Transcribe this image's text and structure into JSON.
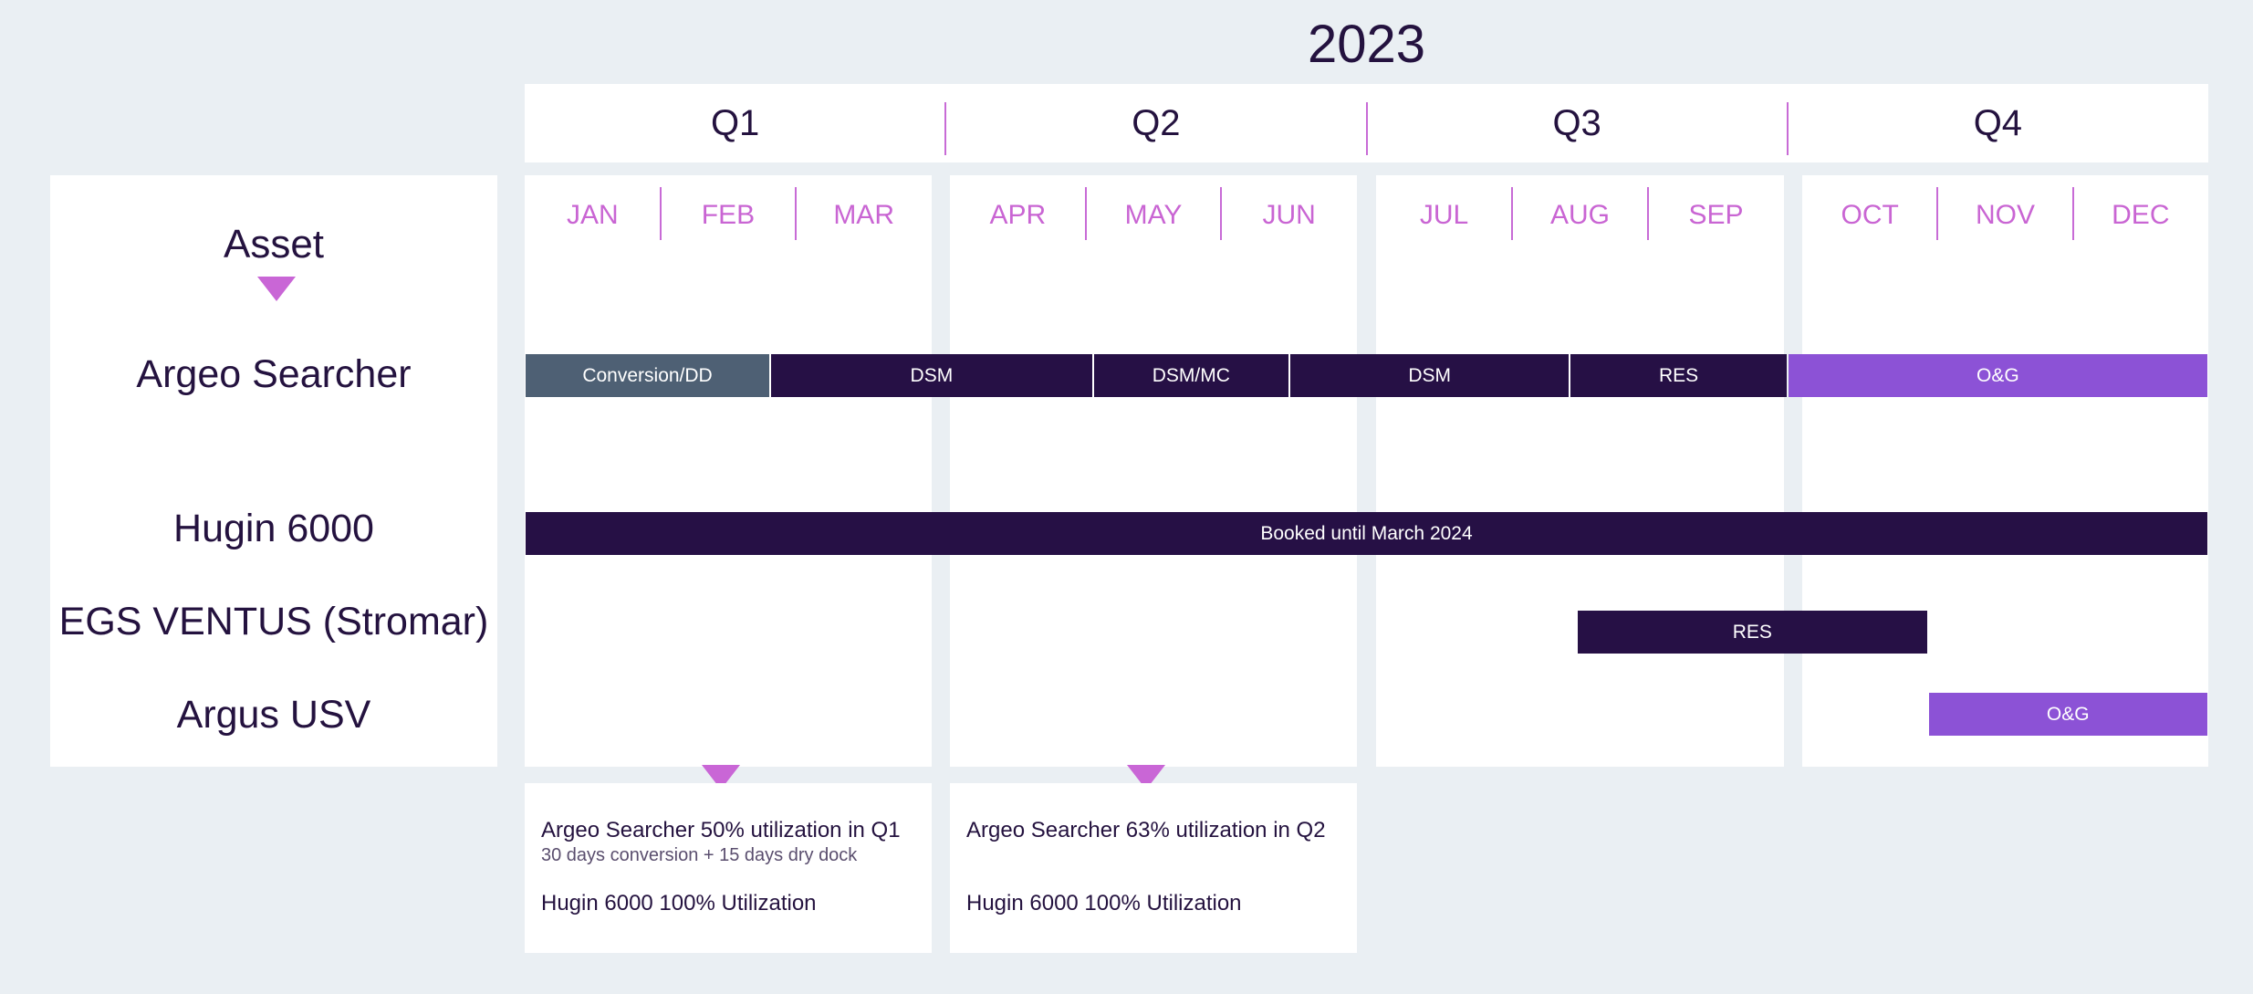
{
  "chart_data": {
    "type": "gantt",
    "title": "2023",
    "quarters": [
      "Q1",
      "Q2",
      "Q3",
      "Q4"
    ],
    "months": [
      "JAN",
      "FEB",
      "MAR",
      "APR",
      "MAY",
      "JUN",
      "JUL",
      "AUG",
      "SEP",
      "OCT",
      "NOV",
      "DEC"
    ],
    "asset_header": "Asset",
    "assets": [
      {
        "name": "Argeo Searcher"
      },
      {
        "name": "Hugin 6000"
      },
      {
        "name": "EGS VENTUS (Stromar)"
      },
      {
        "name": "Argus USV"
      }
    ],
    "tasks": [
      {
        "asset": 0,
        "label": "Conversion/DD",
        "start_month": 0.0,
        "end_month": 1.75,
        "color": "#4e6074"
      },
      {
        "asset": 0,
        "label": "DSM",
        "start_month": 1.75,
        "end_month": 4.05,
        "color": "#261045"
      },
      {
        "asset": 0,
        "label": "DSM/MC",
        "start_month": 4.05,
        "end_month": 5.45,
        "color": "#261045"
      },
      {
        "asset": 0,
        "label": "DSM",
        "start_month": 5.45,
        "end_month": 7.45,
        "color": "#261045"
      },
      {
        "asset": 0,
        "label": "RES",
        "start_month": 7.45,
        "end_month": 9.0,
        "color": "#261045"
      },
      {
        "asset": 0,
        "label": "O&G",
        "start_month": 9.0,
        "end_month": 12.0,
        "color": "#8c52d6"
      },
      {
        "asset": 1,
        "label": "Booked until March 2024",
        "start_month": 0.0,
        "end_month": 12.0,
        "color": "#261045"
      },
      {
        "asset": 2,
        "label": "RES",
        "start_month": 7.5,
        "end_month": 10.0,
        "color": "#261045"
      },
      {
        "asset": 3,
        "label": "O&G",
        "start_month": 10.0,
        "end_month": 12.0,
        "color": "#8c52d6"
      }
    ],
    "notes": [
      {
        "quarter": "Q1",
        "title": "Argeo Searcher 50% utilization in Q1",
        "subtitle": "30 days conversion + 15 days dry dock",
        "line2": "Hugin 6000 100% Utilization"
      },
      {
        "quarter": "Q2",
        "title": "Argeo Searcher 63% utilization in Q2",
        "subtitle": "",
        "line2": "Hugin 6000 100% Utilization"
      }
    ],
    "colors": {
      "background": "#eaeff3",
      "panel": "#ffffff",
      "text": "#24123f",
      "accent": "#c965d3",
      "dark_bar": "#261045",
      "grey_bar": "#4e6074",
      "purple_bar": "#8c52d6"
    }
  }
}
